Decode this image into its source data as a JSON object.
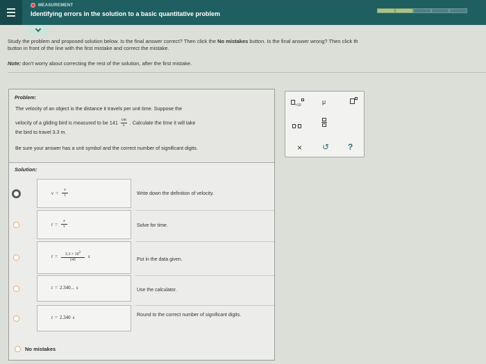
{
  "header": {
    "topic": "MEASUREMENT",
    "title": "Identifying errors in the solution to a basic quantitative problem",
    "progress": {
      "completed_segments": 2,
      "total_segments": 5
    }
  },
  "instructions": {
    "line1_a": "Study the problem and proposed solution below. Is the final answer correct? Then click the ",
    "line1_bold": "No mistakes",
    "line1_b": " button. Is the final answer wrong? Then click th",
    "line2": "button in front of the line with the first mistake and correct the mistake.",
    "note_label": "Note:",
    "note_text": " don't worry about correcting the rest of the solution, after the first mistake."
  },
  "problem": {
    "label": "Problem:",
    "line1": "The velocity of an object is the distance it travels per unit time. Suppose the",
    "line2_a": "velocity of a gliding bird is measured to be 141",
    "unit_num": "cm",
    "unit_den": "s",
    "line2_b": ". Calculate the time it will take",
    "line3": "the bird to travel 3.3 m.",
    "line4": "Be sure your answer has a unit symbol and the correct number of significant digits."
  },
  "solution": {
    "label": "Solution:",
    "rows": [
      {
        "lhs": "v",
        "eq": "=",
        "num": "z",
        "den": "t",
        "note": "Write down the definition of velocity."
      },
      {
        "lhs": "t",
        "eq": "=",
        "num": "z",
        "den": "v",
        "note": "Solve for time."
      },
      {
        "lhs": "t",
        "eq": "=",
        "num": "3.3 × 10",
        "exp": "2",
        "den": "141",
        "unit": "s",
        "note": "Put in the data given."
      },
      {
        "lhs": "t",
        "eq": "=",
        "value": "2.340...",
        "unit": "s",
        "note": "Use the calculator."
      },
      {
        "lhs": "t",
        "eq": "=",
        "value": "2.340",
        "unit": "s",
        "note": "Round to the correct number of significant digits."
      }
    ],
    "no_mistakes_label": "No mistakes"
  },
  "palette": {
    "times10_label": "×10",
    "mu": "μ",
    "dot": "·",
    "clear": "×",
    "undo": "↺",
    "help": "?"
  },
  "colors": {
    "header_bg": "#1f5f62",
    "accent": "#2d6f73",
    "radio_border": "#e6a96d"
  }
}
